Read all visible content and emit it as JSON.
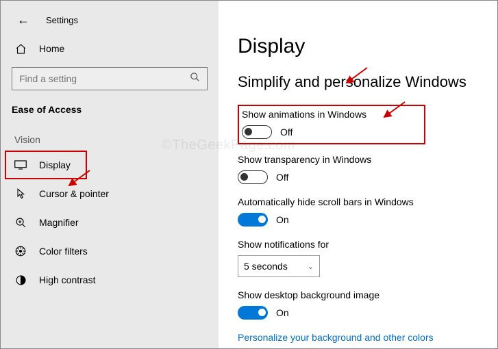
{
  "window": {
    "title": "Settings"
  },
  "sidebar": {
    "home": "Home",
    "search_placeholder": "Find a setting",
    "category": "Ease of Access",
    "section": "Vision",
    "items": [
      {
        "label": "Display"
      },
      {
        "label": "Cursor & pointer"
      },
      {
        "label": "Magnifier"
      },
      {
        "label": "Color filters"
      },
      {
        "label": "High contrast"
      }
    ]
  },
  "main": {
    "heading": "Display",
    "subheading": "Simplify and personalize Windows",
    "settings": {
      "animations": {
        "label": "Show animations in Windows",
        "state": "Off"
      },
      "transparency": {
        "label": "Show transparency in Windows",
        "state": "Off"
      },
      "scrollbars": {
        "label": "Automatically hide scroll bars in Windows",
        "state": "On"
      },
      "notifications": {
        "label": "Show notifications for",
        "value": "5 seconds"
      },
      "background": {
        "label": "Show desktop background image",
        "state": "On"
      }
    },
    "link": "Personalize your background and other colors"
  },
  "watermark": "©TheGeekPage.com"
}
